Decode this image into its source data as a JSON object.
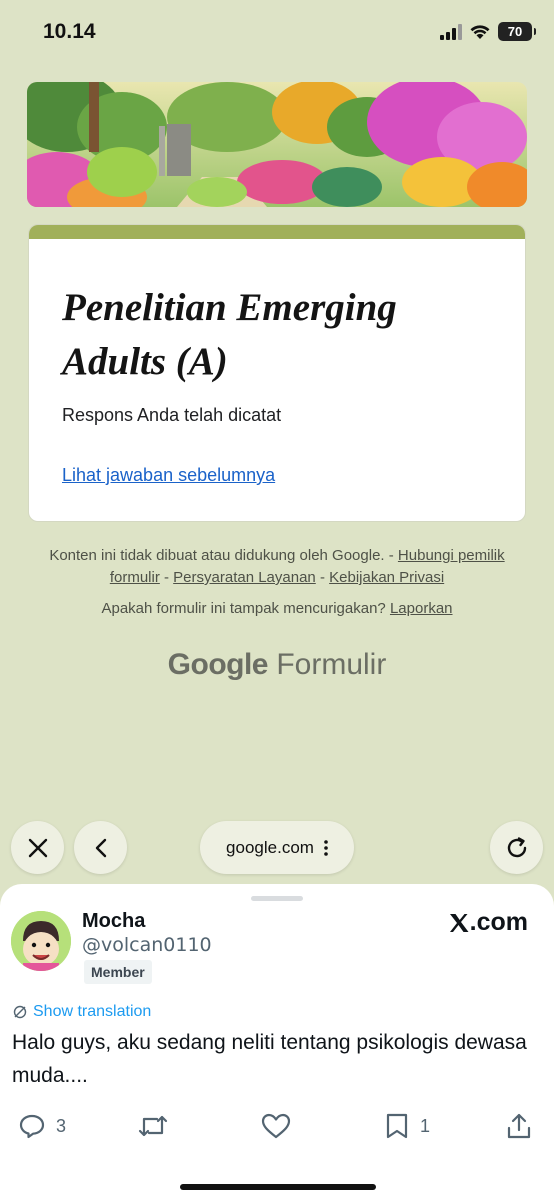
{
  "status": {
    "time": "10.14",
    "battery": "70"
  },
  "form": {
    "title": "Penelitian Emerging Adults (A)",
    "response_message": "Respons Anda telah dicatat",
    "view_previous_link": "Lihat jawaban sebelumnya",
    "theme_color": "#a1b05a"
  },
  "footer": {
    "disclaimer": "Konten ini tidak dibuat atau didukung oleh Google. -",
    "contact_owner": "Hubungi pemilik formulir",
    "sep1": "-",
    "terms": "Persyaratan Layanan",
    "sep2": "-",
    "privacy": "Kebijakan Privasi",
    "suspicious_question": "Apakah formulir ini tampak mencurigakan?",
    "report_link": "Laporkan",
    "brand_google": "Google",
    "brand_product": "Formulir"
  },
  "browser": {
    "url": "google.com"
  },
  "tweet": {
    "name": "Mocha",
    "handle": "@volcan0110",
    "badge": "Member",
    "source": ".com",
    "translate_label": "Show translation",
    "text": "Halo guys, aku sedang neliti tentang psikologis dewasa muda....",
    "reply_count": "3",
    "bookmark_count": "1",
    "link_color": "#1d9bf0"
  }
}
